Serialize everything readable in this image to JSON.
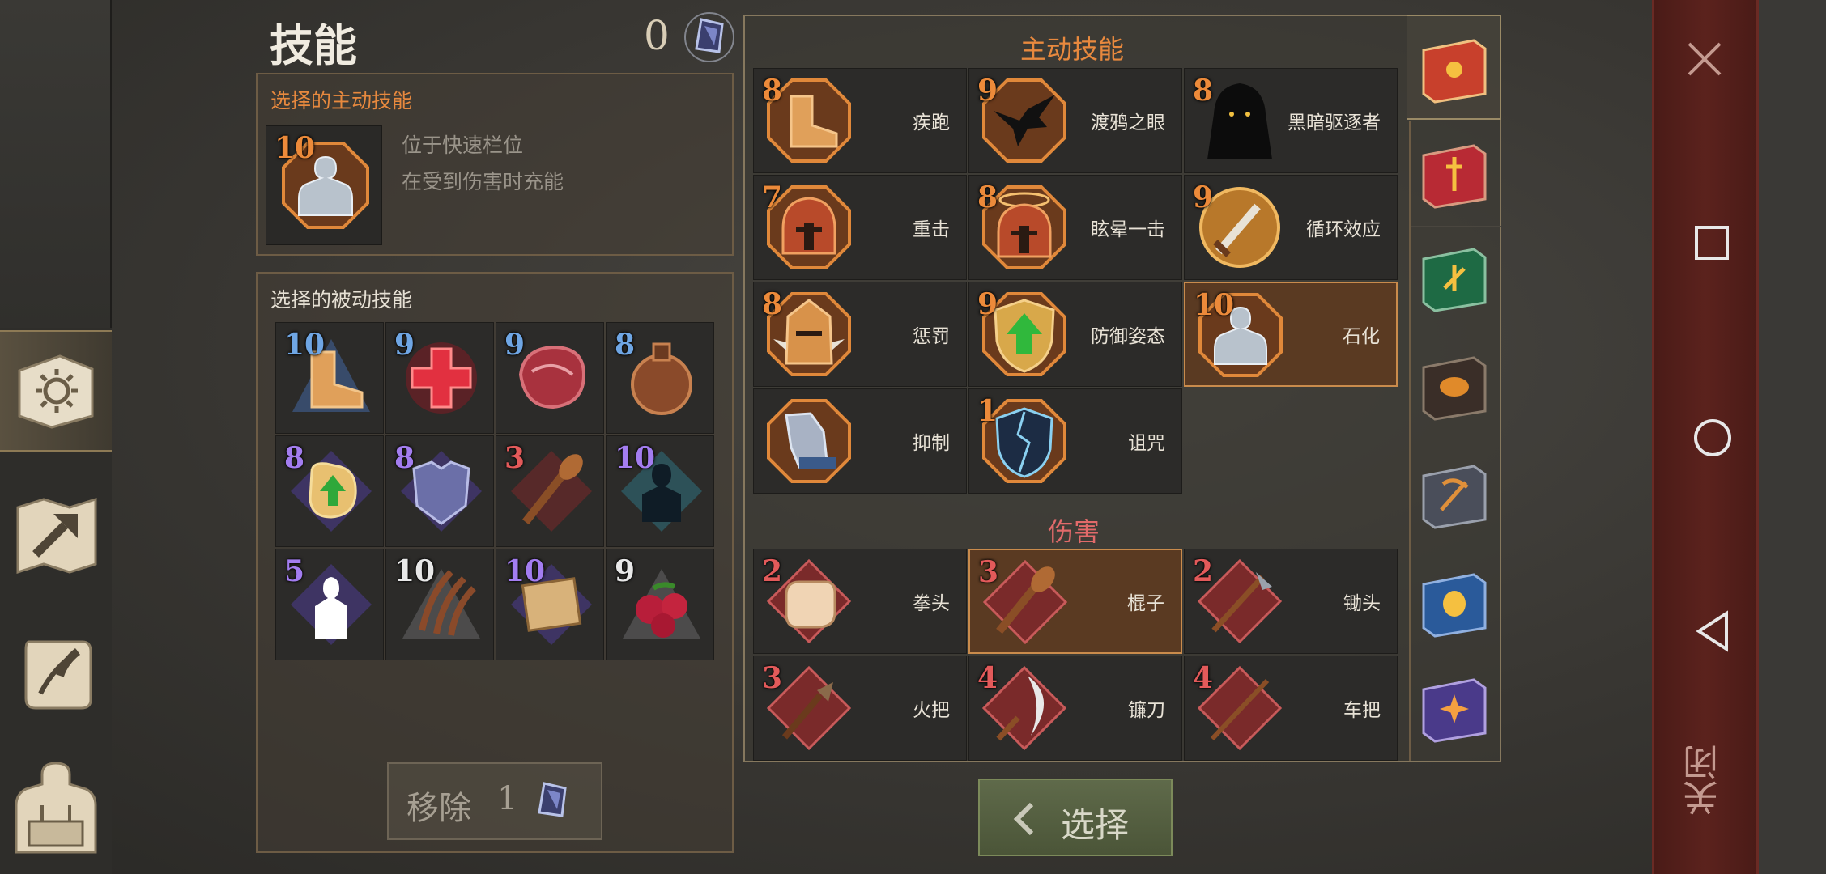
{
  "header": {
    "title": "技能",
    "points": "0"
  },
  "active_selected": {
    "title": "选择的主动技能",
    "skill": {
      "level": "10",
      "icon": "petrify-statue-icon"
    },
    "lines": [
      "位于快速栏位",
      "在受到伤害时充能"
    ]
  },
  "passive_selected": {
    "title": "选择的被动技能",
    "skills": [
      {
        "level": "10",
        "icon": "boot-icon"
      },
      {
        "level": "9",
        "icon": "red-cross-icon"
      },
      {
        "level": "9",
        "icon": "meat-icon"
      },
      {
        "level": "8",
        "icon": "flask-icon"
      },
      {
        "level": "8",
        "icon": "stomach-arrow-icon"
      },
      {
        "level": "8",
        "icon": "chest-armor-icon"
      },
      {
        "level": "3",
        "icon": "club-icon"
      },
      {
        "level": "10",
        "icon": "aura-silhouette-icon"
      },
      {
        "level": "5",
        "icon": "shadow-demon-icon"
      },
      {
        "level": "10",
        "icon": "claw-marks-icon"
      },
      {
        "level": "10",
        "icon": "map-scroll-icon"
      },
      {
        "level": "9",
        "icon": "berries-icon"
      }
    ]
  },
  "remove_button": {
    "label": "移除",
    "cost": "1"
  },
  "active_skills": {
    "title": "主动技能",
    "skills": [
      {
        "level": "8",
        "name": "疾跑",
        "icon": "boot-icon"
      },
      {
        "level": "9",
        "name": "渡鸦之眼",
        "icon": "raven-icon"
      },
      {
        "level": "8",
        "name": "黑暗驱逐者",
        "icon": "hooded-figure-icon"
      },
      {
        "level": "7",
        "name": "重击",
        "icon": "helmet-strike-icon"
      },
      {
        "level": "8",
        "name": "眩晕一击",
        "icon": "helmet-halo-icon"
      },
      {
        "level": "9",
        "name": "循环效应",
        "icon": "sword-coin-icon"
      },
      {
        "level": "8",
        "name": "惩罚",
        "icon": "spiked-helmet-icon"
      },
      {
        "level": "9",
        "name": "防御姿态",
        "icon": "shield-arrow-icon"
      },
      {
        "level": "10",
        "name": "石化",
        "icon": "petrify-statue-icon"
      },
      {
        "level": "",
        "name": "抑制",
        "icon": "chained-hand-icon"
      },
      {
        "level": "1",
        "name": "诅咒",
        "icon": "cracked-shield-icon"
      }
    ]
  },
  "damage_skills": {
    "title": "伤害",
    "skills": [
      {
        "level": "2",
        "name": "拳头",
        "icon": "fist-icon"
      },
      {
        "level": "3",
        "name": "棍子",
        "icon": "club-icon"
      },
      {
        "level": "2",
        "name": "锄头",
        "icon": "hoe-icon"
      },
      {
        "level": "3",
        "name": "火把",
        "icon": "torch-icon"
      },
      {
        "level": "4",
        "name": "镰刀",
        "icon": "sickle-icon"
      },
      {
        "level": "4",
        "name": "车把",
        "icon": "pole-icon"
      }
    ]
  },
  "select_button": {
    "label": "选择"
  },
  "close_label": "关闭",
  "books": [
    "sun-book-icon",
    "dagger-book-icon",
    "leaf-book-icon",
    "mask-book-icon",
    "pickaxe-book-icon",
    "theater-book-icon",
    "compass-book-icon"
  ],
  "colors": {
    "accent": "#e07b3a",
    "damage_title": "#e26a6a",
    "panel_border": "#6d5c45",
    "selected_border": "#c98b4c"
  }
}
